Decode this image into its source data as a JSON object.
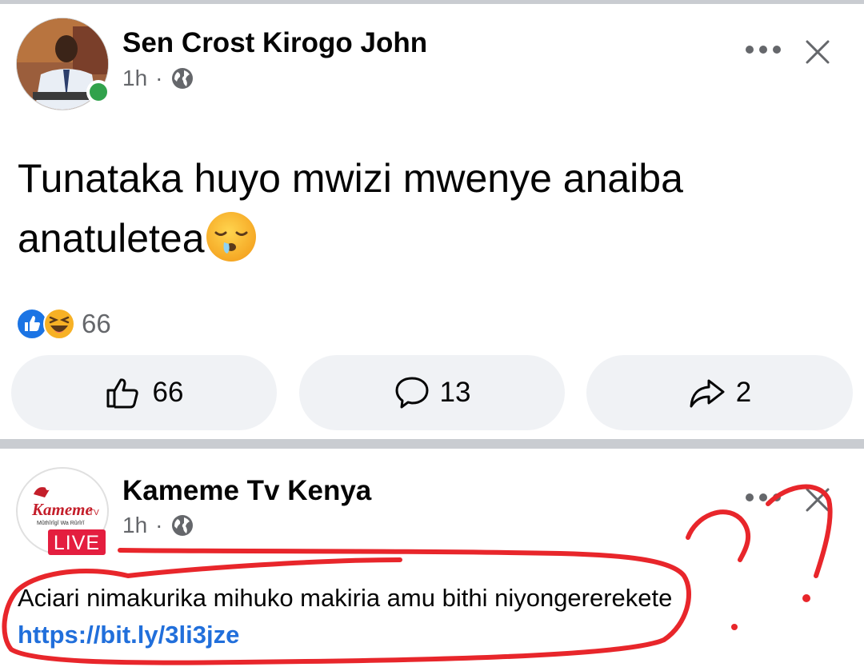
{
  "post1": {
    "author": "Sen Crost Kirogo John",
    "time": "1h",
    "separator": "·",
    "text": "Tunataka huyo mwizi mwenye anaiba anatuletea",
    "reactions_count": "66",
    "actions": {
      "like_count": "66",
      "comment_count": "13",
      "share_count": "2"
    }
  },
  "post2": {
    "author": "Kameme Tv Kenya",
    "time": "1h",
    "separator": "·",
    "logo_text": "Kameme",
    "logo_tv": "TV",
    "logo_tagline": "Mũthĩrĩgĩ Wa Rũrĩrĩ",
    "live_label": "LIVE",
    "text": "Aciari nimakurika mihuko makiria amu bithi niyongererekete ",
    "link": "https://bit.ly/3li3jze"
  },
  "colors": {
    "online": "#31a24c",
    "link": "#216fdb",
    "live": "#e41e3f",
    "scribble": "#e8262b",
    "button_bg": "#f0f2f5"
  },
  "icons": [
    "globe-icon",
    "more-icon",
    "close-icon",
    "like-icon",
    "comment-icon",
    "share-icon",
    "like-reaction-icon",
    "haha-reaction-icon",
    "crying-face-emoji"
  ]
}
